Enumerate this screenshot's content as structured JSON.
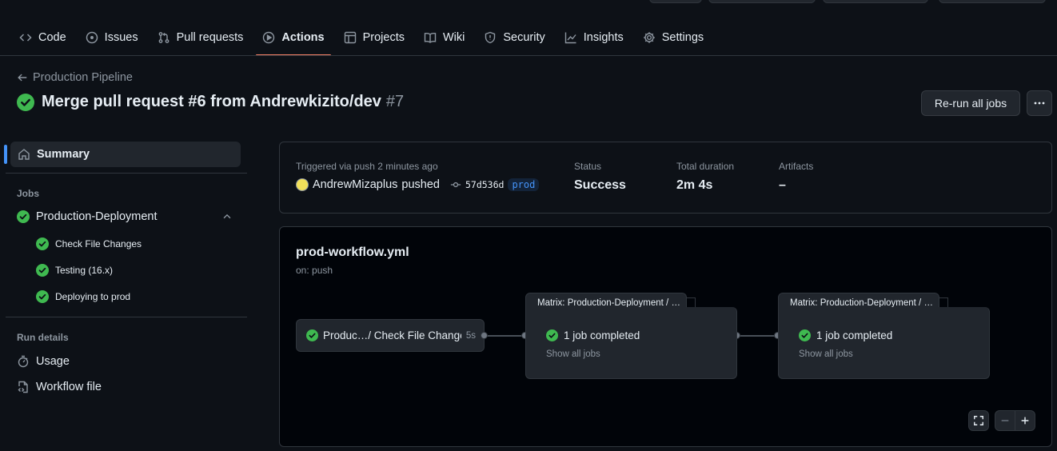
{
  "nav": {
    "tabs": [
      {
        "label": "Code",
        "icon": "code-icon",
        "active": false
      },
      {
        "label": "Issues",
        "icon": "issue-icon",
        "active": false
      },
      {
        "label": "Pull requests",
        "icon": "pull-request-icon",
        "active": false
      },
      {
        "label": "Actions",
        "icon": "play-icon",
        "active": true
      },
      {
        "label": "Projects",
        "icon": "table-icon",
        "active": false
      },
      {
        "label": "Wiki",
        "icon": "book-icon",
        "active": false
      },
      {
        "label": "Security",
        "icon": "shield-icon",
        "active": false
      },
      {
        "label": "Insights",
        "icon": "graph-icon",
        "active": false
      },
      {
        "label": "Settings",
        "icon": "gear-icon",
        "active": false
      }
    ]
  },
  "header": {
    "back_label": "Production Pipeline",
    "title": "Merge pull request #6 from Andrewkizito/dev",
    "run_number": "#7",
    "rerun_label": "Re-run all jobs"
  },
  "sidebar": {
    "summary_label": "Summary",
    "jobs_heading": "Jobs",
    "job_label": "Production-Deployment",
    "steps": [
      "Check File Changes",
      "Testing (16.x)",
      "Deploying to prod"
    ],
    "run_details_heading": "Run details",
    "usage_label": "Usage",
    "workflow_file_label": "Workflow file"
  },
  "summary": {
    "trigger_text": "Triggered via push 2 minutes ago",
    "actor": "AndrewMizaplus",
    "action": "pushed",
    "commit_sha": "57d536d",
    "branch": "prod",
    "status_label": "Status",
    "status_value": "Success",
    "duration_label": "Total duration",
    "duration_value": "2m 4s",
    "artifacts_label": "Artifacts",
    "artifacts_value": "–"
  },
  "graph": {
    "workflow_name": "prod-workflow.yml",
    "trigger": "on: push",
    "job_node": {
      "label": "Produc…/ Check File Changes",
      "duration": "5s"
    },
    "matrix_nodes": [
      {
        "title": "Matrix: Production-Deployment / …",
        "status": "1 job completed",
        "show_all": "Show all jobs"
      },
      {
        "title": "Matrix: Production-Deployment / …",
        "status": "1 job completed",
        "show_all": "Show all jobs"
      }
    ]
  },
  "colors": {
    "success": "#3fb950",
    "accent": "#f78166",
    "link": "#4493f8"
  }
}
